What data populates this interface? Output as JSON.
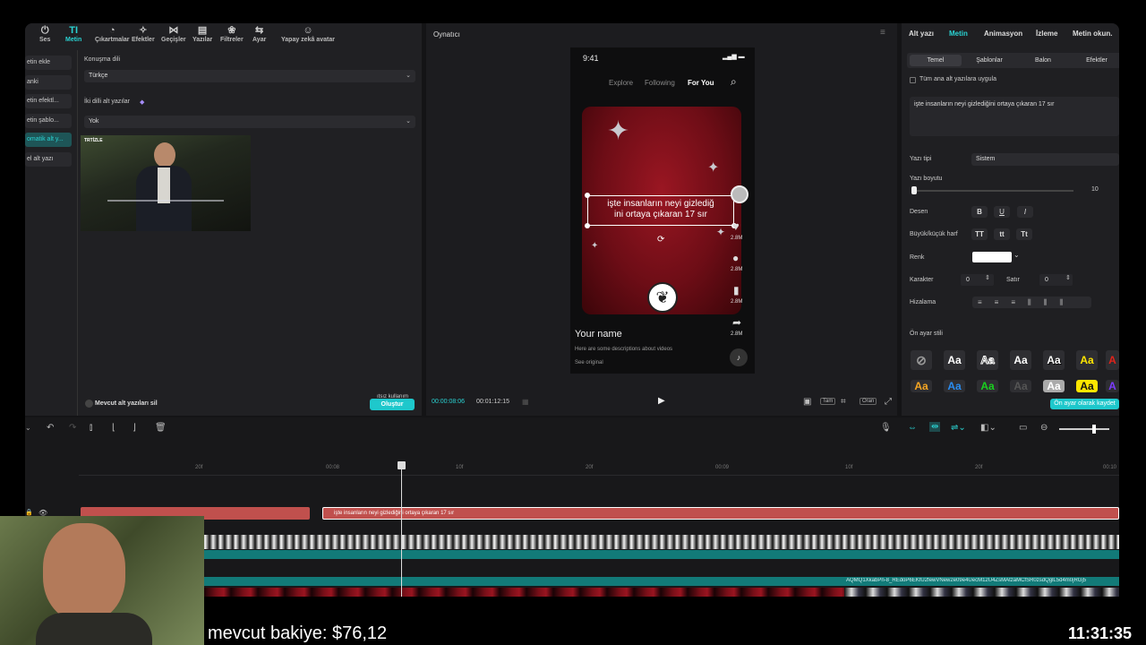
{
  "toolbar": {
    "items": [
      {
        "label": "Ses",
        "icon": "⏻"
      },
      {
        "label": "Metin",
        "icon": "TI"
      },
      {
        "label": "Çıkartmalar",
        "icon": "◔"
      },
      {
        "label": "Efektler",
        "icon": "✧"
      },
      {
        "label": "Geçişler",
        "icon": "⋈"
      },
      {
        "label": "Yazılar",
        "icon": "▤"
      },
      {
        "label": "Filtreler",
        "icon": "❀"
      },
      {
        "label": "Ayar",
        "icon": "⇆"
      },
      {
        "label": "Yapay zekâ avatar",
        "icon": "☺"
      }
    ]
  },
  "sidebar": {
    "items": [
      {
        "label": "etin ekle"
      },
      {
        "label": "anki"
      },
      {
        "label": "etin efektl..."
      },
      {
        "label": "etin şablo..."
      },
      {
        "label": "omatik alt y..."
      },
      {
        "label": "el alt yazı"
      }
    ]
  },
  "left": {
    "lang_label": "Konuşma dili",
    "lang_value": "Türkçe",
    "bi_label": "İki dilli alt yazılar",
    "bi_value": "Yok",
    "thumb_tag": "TRTİZLE",
    "delete_label": "Mevcut alt yazıları sil",
    "create_btn": "Oluştur",
    "create_badge": "ıtsız kullanım"
  },
  "player": {
    "title": "Oynatıcı",
    "time_current": "00:00:08:06",
    "time_total": "00:01:12:15",
    "btn_orig": "Tam",
    "btn_ratio": "Oran"
  },
  "phone": {
    "clock": "9:41",
    "tab_explore": "Explore",
    "tab_following": "Following",
    "tab_foryou": "For You",
    "caption": "işte insanların neyi gizlediğini ortaya çıkaran 17 sır",
    "caption_line1": "işte insanların neyi gizlediğ",
    "caption_line2": "ini ortaya çıkaran 17 sır",
    "name": "Your name",
    "desc": "Here are some descriptions about videos",
    "see_original": "See original",
    "stat1": "2.8M",
    "stat2": "2.8M",
    "stat3": "2.8M",
    "stat4": "2.8M"
  },
  "right": {
    "tabs": [
      "Alt yazı",
      "Metin",
      "Animasyon",
      "İzleme",
      "Metin okun."
    ],
    "subtabs": [
      "Temel",
      "Şablonlar",
      "Balon",
      "Efektler"
    ],
    "apply_all": "Tüm ana alt yazılara uygula",
    "text_value": "işte insanların neyi gizlediğini ortaya çıkaran 17 sır",
    "font_label": "Yazı tipi",
    "font_value": "Sistem",
    "size_label": "Yazı boyutu",
    "size_value": "10",
    "pattern_label": "Desen",
    "case_label": "Büyük/küçük harf",
    "color_label": "Renk",
    "char_label": "Karakter",
    "char_value": "0",
    "line_label": "Satır",
    "line_value": "0",
    "align_label": "Hizalama",
    "preset_label": "Ön ayar stili",
    "preset_btn": "Ön ayar olarak kaydet",
    "text_color": "#ffffff"
  },
  "timeline": {
    "ruler": [
      "20f",
      "00:08",
      "10f",
      "20f",
      "00:09",
      "10f",
      "20f",
      "00:10"
    ],
    "caption_clip": "işte insanların neyi gizlediğini ortaya çıkaran 17 sır",
    "video_clip_name": "AQMQ1XkabPn-8_REdoP6EKfU2fewVNew2e09e4UecM12U4ZsMAtzaMCfSR0zsdQglL5d4m0jRGj5"
  },
  "overlay": {
    "balance": "mevcut bakiye: $76,12",
    "clock": "11:31:35"
  },
  "colors": {
    "accent": "#2ad3d3",
    "caption_clip": "#c0504d",
    "audio_track": "#127a78"
  }
}
